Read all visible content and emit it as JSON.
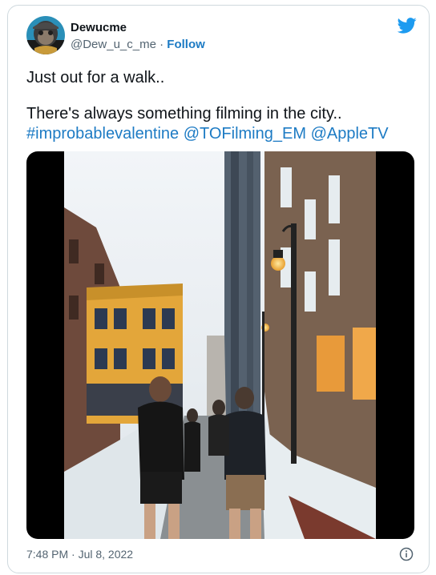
{
  "tweet": {
    "display_name": "Dewucme",
    "handle": "@Dew_u_c_me",
    "separator": "·",
    "follow_label": "Follow",
    "line1": "Just out for a walk..",
    "line2": "There's always something filming in the city..",
    "hashtag": "#improbablevalentine",
    "mention1": "@TOFilming_EM",
    "mention2": "@AppleTV",
    "timestamp": "7:48 PM · Jul 8, 2022"
  },
  "icons": {
    "brand": "twitter-bird-icon",
    "info": "info-icon",
    "avatar": "avatar-image"
  },
  "colors": {
    "brand": "#1d9bf0",
    "link": "#1d7bc4",
    "text": "#0f1419",
    "muted": "#536471",
    "border": "#cfd9de"
  }
}
